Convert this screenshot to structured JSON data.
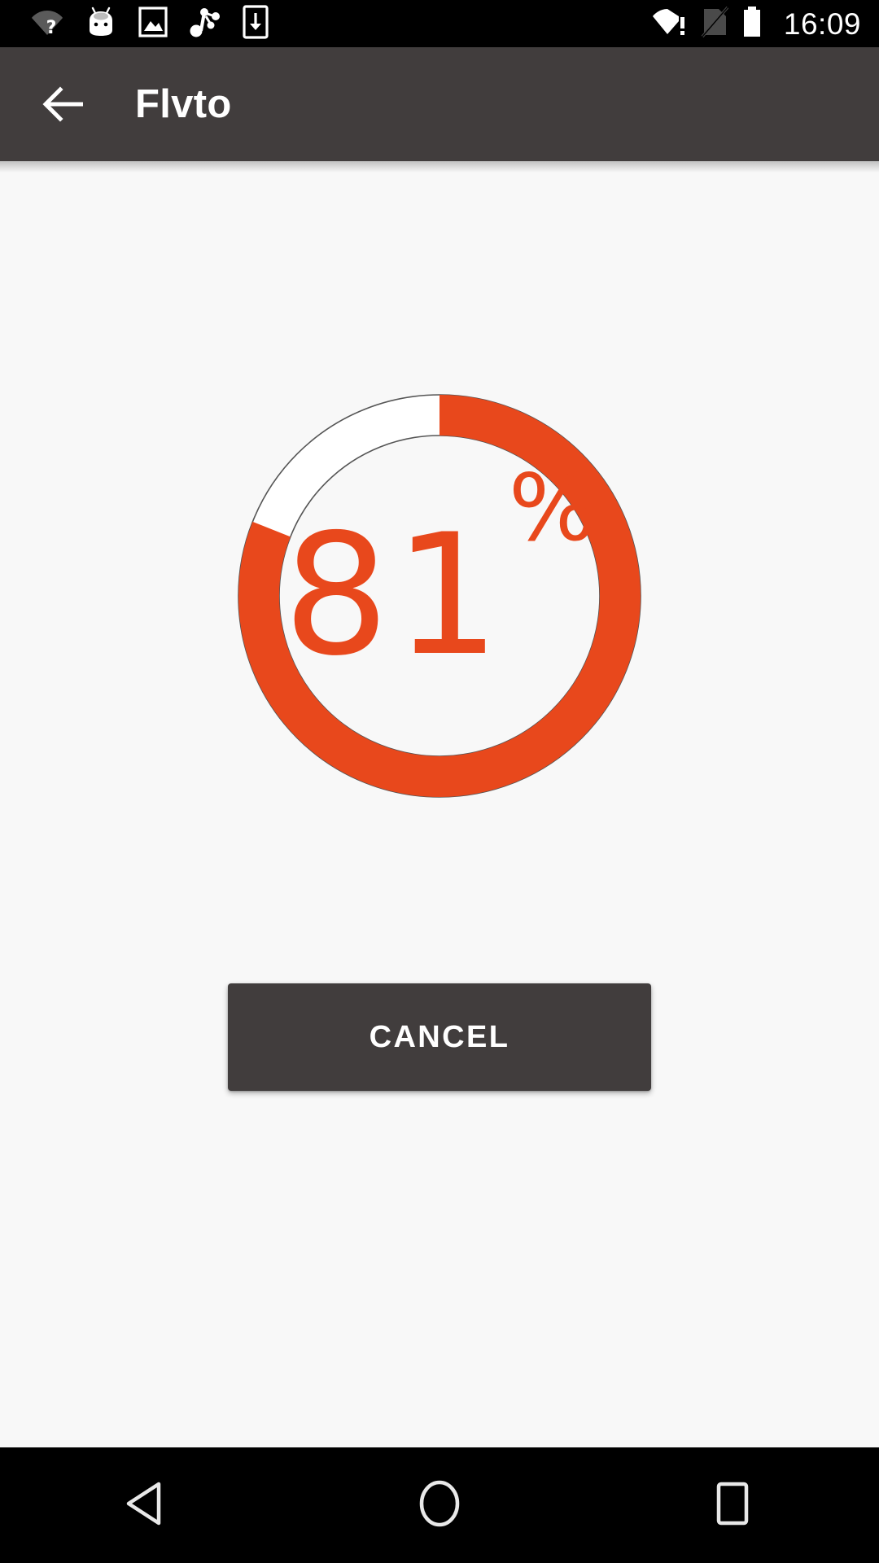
{
  "status_bar": {
    "time": "16:09",
    "left_icons": [
      {
        "name": "wifi-question-icon",
        "label": "Wi-Fi sign-in required"
      },
      {
        "name": "android-head-icon",
        "label": "Android system"
      },
      {
        "name": "image-icon",
        "label": "Screenshot captured"
      },
      {
        "name": "music-node-icon",
        "label": "Media"
      },
      {
        "name": "download-icon",
        "label": "Download in progress"
      }
    ],
    "right_icons": [
      {
        "name": "wifi-alert-icon",
        "label": "Wi-Fi no internet"
      },
      {
        "name": "no-sim-icon",
        "label": "No SIM card"
      },
      {
        "name": "battery-full-icon",
        "label": "Battery full"
      }
    ]
  },
  "app_bar": {
    "title": "Flvto",
    "back_label": "Navigate up"
  },
  "progress": {
    "percent": 81,
    "value_text": "81",
    "percent_sign": "%",
    "track_color": "#ffffff",
    "fill_color": "#e8481c",
    "outline_color": "#555555"
  },
  "actions": {
    "cancel_label": "CANCEL"
  },
  "nav_bar": {
    "back_label": "Back",
    "home_label": "Home",
    "recents_label": "Recent apps"
  },
  "theme": {
    "accent": "#e8481c",
    "app_bar_bg": "#413d3d",
    "page_bg": "#f8f8f8",
    "system_bar_bg": "#000000"
  }
}
